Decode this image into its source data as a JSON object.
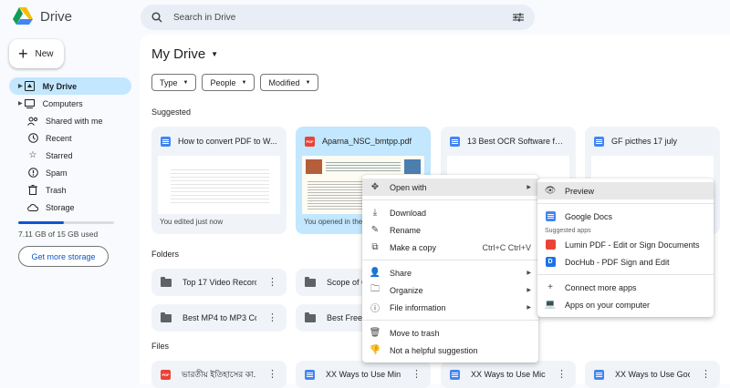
{
  "app": {
    "name": "Drive"
  },
  "search": {
    "placeholder": "Search in Drive"
  },
  "new_button": {
    "label": "New"
  },
  "sidebar": {
    "items": [
      {
        "label": "My Drive",
        "icon": "my-drive-icon"
      },
      {
        "label": "Computers",
        "icon": "computer-icon"
      },
      {
        "label": "Shared with me",
        "icon": "people-icon"
      },
      {
        "label": "Recent",
        "icon": "clock-icon"
      },
      {
        "label": "Starred",
        "icon": "star-icon"
      },
      {
        "label": "Spam",
        "icon": "spam-icon"
      },
      {
        "label": "Trash",
        "icon": "trash-icon"
      },
      {
        "label": "Storage",
        "icon": "cloud-icon"
      }
    ]
  },
  "storage": {
    "used_text": "7.11 GB of 15 GB used",
    "used_fraction": 0.474,
    "button": "Get more storage"
  },
  "main": {
    "title": "My Drive",
    "filters": [
      "Type",
      "People",
      "Modified"
    ],
    "suggested_label": "Suggested",
    "folders_label": "Folders",
    "files_label": "Files"
  },
  "suggested": [
    {
      "name": "How to convert PDF to W...",
      "type": "doc",
      "footer": "You edited just now"
    },
    {
      "name": "Aparna_NSC_bmtpp.pdf",
      "type": "pdf",
      "footer": "You opened in the past..."
    },
    {
      "name": "13 Best OCR Software for...",
      "type": "doc",
      "footer": ""
    },
    {
      "name": "GF picthes 17 july",
      "type": "doc",
      "footer": ""
    }
  ],
  "folders": [
    {
      "name": "Top 17 Video Record..."
    },
    {
      "name": "Scope of C..."
    },
    {
      "name": "Best MP4 to MP3 Co..."
    },
    {
      "name": "Best Free..."
    }
  ],
  "files": [
    {
      "name": "ভারতীয় ইতিহাসের কা...",
      "type": "pdf"
    },
    {
      "name": "XX Ways to Use Min...",
      "type": "doc"
    },
    {
      "name": "XX Ways to Use Mic...",
      "type": "doc"
    },
    {
      "name": "XX Ways to Use Goo...",
      "type": "doc"
    }
  ],
  "context_menu": {
    "items": [
      {
        "label": "Open with",
        "icon": "move-icon",
        "submenu": true
      },
      {
        "label": "Download",
        "icon": "download-icon"
      },
      {
        "label": "Rename",
        "icon": "edit-icon"
      },
      {
        "label": "Make a copy",
        "icon": "copy-icon",
        "shortcut": "Ctrl+C Ctrl+V"
      },
      {
        "label": "Share",
        "icon": "share-icon",
        "submenu": true
      },
      {
        "label": "Organize",
        "icon": "folder-icon",
        "submenu": true
      },
      {
        "label": "File information",
        "icon": "info-icon",
        "submenu": true
      },
      {
        "label": "Move to trash",
        "icon": "trash-icon"
      },
      {
        "label": "Not a helpful suggestion",
        "icon": "thumbs-down-icon"
      }
    ]
  },
  "open_with_menu": {
    "preview": "Preview",
    "google_docs": "Google Docs",
    "suggested_label": "Suggested apps",
    "apps": [
      "Lumin PDF - Edit or Sign Documents",
      "DocHub - PDF Sign and Edit"
    ],
    "connect": "Connect more apps",
    "computer": "Apps on your computer"
  }
}
